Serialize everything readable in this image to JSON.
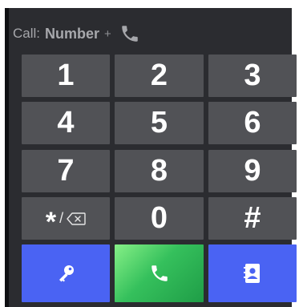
{
  "call_bar": {
    "label": "Call:",
    "number": "Number",
    "plus": "+",
    "icon": "phone-icon"
  },
  "keypad": {
    "keys": [
      {
        "label": "1"
      },
      {
        "label": "2"
      },
      {
        "label": "3"
      },
      {
        "label": "4"
      },
      {
        "label": "5"
      },
      {
        "label": "6"
      },
      {
        "label": "7"
      },
      {
        "label": "8"
      },
      {
        "label": "9"
      },
      {
        "label": "*",
        "secondary": "/",
        "icon": "backspace-icon"
      },
      {
        "label": "0"
      },
      {
        "label": "#"
      }
    ]
  },
  "actions": {
    "left": {
      "icon": "key-icon"
    },
    "center": {
      "icon": "phone-icon"
    },
    "right": {
      "icon": "contacts-book-icon"
    }
  },
  "colors": {
    "panel": "#2b2c30",
    "key": "#515256",
    "accent_blue": "#4a63f3",
    "call_green": "#35c05c",
    "muted_text": "#a6a7ab"
  }
}
